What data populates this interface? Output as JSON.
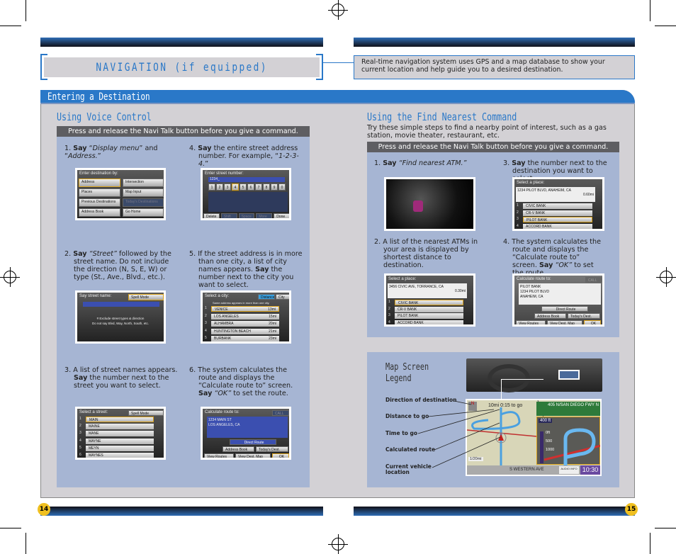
{
  "title": "NAVIGATION (if equipped)",
  "intro": "Real-time navigation system uses GPS and a map database to show your current location and help guide you to a desired destination.",
  "section_title": "Entering a Destination",
  "voice": {
    "heading": "Using Voice Control",
    "banner": "Press and release the Navi Talk button before you give a command.",
    "steps": [
      {
        "n": "1.",
        "say": "Say",
        "rest_a": " “",
        "it1": "Display menu",
        "rest_b": "” and “",
        "it2": "Address.",
        "rest_c": "”"
      },
      {
        "n": "4.",
        "say": "Say",
        "text": " the entire street address number. For example, “",
        "it": "1-2-3-4.",
        "end": "”"
      },
      {
        "n": "2.",
        "say": "Say",
        "it": " “Street”",
        "text": " followed by the street name. Do not include the direction (N, S, E, W) or type (St., Ave., Blvd., etc.)."
      },
      {
        "n": "5.",
        "pre": "If the street address is in more than one city,  a list of city names appears. ",
        "say": "Say",
        "text": " the number next to the city you want to select."
      },
      {
        "n": "3.",
        "pre": "A list of street names appears. ",
        "say": "Say",
        "text": " the number next to the street you want to select."
      },
      {
        "n": "6.",
        "pre": "The system calculates the route and displays the “Calculate route to” screen. ",
        "say": "Say",
        "it": " “OK”",
        "text": " to set the route."
      }
    ],
    "screens": {
      "menu": {
        "title": "Enter destination by:",
        "items": [
          "Address",
          "Intersection",
          "Places",
          "Map Input",
          "Previous Destinations",
          "Today's Destinations",
          "Address Book",
          "Go Home"
        ]
      },
      "number": {
        "title": "Enter street number:",
        "value": "1234_",
        "keys": [
          "1",
          "2",
          "3",
          "4",
          "5",
          "6",
          "7",
          "8",
          "9",
          "0"
        ],
        "bottom": [
          "Delete",
          "Shift",
          "Space",
          "More",
          "Done"
        ]
      },
      "street": {
        "title": "Say street name:",
        "mode": "Spell Mode",
        "hint1": "# Exclude street types & direction",
        "hint2": "Do not say Blvd, Way, North, South, etc."
      },
      "city": {
        "title": "Select a city:",
        "tabs": [
          "Distance",
          "City"
        ],
        "note": "Same address appears in more than one city.",
        "rows": [
          [
            "VENICE",
            "13mi"
          ],
          [
            "LOS ANGELES",
            "15mi"
          ],
          [
            "ALHAMBRA",
            "20mi"
          ],
          [
            "HUNTINGTON BEACH",
            "21mi"
          ],
          [
            "BURBANK",
            "23mi"
          ]
        ]
      },
      "streets": {
        "title": "Select a street:",
        "mode": "Spell Mode",
        "rows": [
          "MAIN",
          "MAINE",
          "MANE",
          "MAYNE",
          "MEYN",
          "MAYNES"
        ]
      },
      "calc": {
        "title": "Calculate route to:",
        "call": "CALL",
        "addr1": "1234 MAIN ST",
        "addr2": "LOS ANGELES, CA",
        "route": "Direct Route",
        "b1": "Address Book",
        "b2": "Today's Dest.",
        "b3": "View Routes",
        "b4": "View Dest. Map",
        "ok": "OK"
      }
    }
  },
  "nearest": {
    "heading": "Using the Find Nearest Command",
    "intro": "Try these simple steps to find a nearby point of interest, such as a gas station, movie theater, restaurant, etc.",
    "banner": "Press and release the Navi Talk button before you give a command.",
    "steps": [
      {
        "n": "1.",
        "say": "Say",
        "it": " “Find nearest ATM.”"
      },
      {
        "n": "3.",
        "say": "Say",
        "text": " the number next to the destination you want to select."
      },
      {
        "n": "2.",
        "text": "A list of the nearest ATMs in your area is displayed by shortest distance to destination."
      },
      {
        "n": "4.",
        "pre": "The system calculates the route and displays the “Calculate route to” screen. ",
        "say": "Say",
        "it": " “OK”",
        "text": " to set the route."
      }
    ],
    "place1": {
      "title": "Select a place:",
      "addr": "1234 PILOT BLVD, ANAHEIM, CA",
      "dist": "0.60mi",
      "rows": [
        "CIVIC BANK",
        "CR-V BANK",
        "PILOT BANK",
        "ACCORD BANK"
      ]
    },
    "place2": {
      "title": "Select a place:",
      "addr": "3456 CIVIC AVE, TORRANCE, CA",
      "dist": "0.30mi",
      "rows": [
        "CIVIC BANK",
        "CR-V BANK",
        "PILOT BANK",
        "ACCORD BANK"
      ]
    },
    "calc": {
      "title": "Calculate route to:",
      "call": "CALL",
      "addr1": "PILOT BANK",
      "addr2": "1234 PILOT BLVD",
      "addr3": "ANAHEIM, CA",
      "route": "Direct Route",
      "b1": "Address Book",
      "b2": "Today's Dest.",
      "b3": "View Routes",
      "b4": "View Dest. Map",
      "ok": "OK"
    }
  },
  "legend": {
    "heading1": "Map Screen",
    "heading2": "Legend",
    "labels": [
      "Direction of destination",
      "Distance to go",
      "Time to go",
      "Calculated route",
      "Current vehicle location"
    ],
    "map": {
      "eta": "10mi 0:15 to go",
      "road": "405 N/SAN DIEGO FWY N",
      "dist": "400 ft",
      "scale": "1/20mi",
      "street": "S WESTERN AVE",
      "audio": "AUDIO INFO",
      "time": "10:30",
      "ticks": [
        "0ft",
        "500",
        "1000"
      ]
    }
  },
  "pages": {
    "left": "14",
    "right": "15"
  },
  "colors": {
    "accent": "#2a78c8",
    "panel": "#a6b5d3",
    "bg": "#d3d1d5",
    "banner": "#5e5e62"
  }
}
